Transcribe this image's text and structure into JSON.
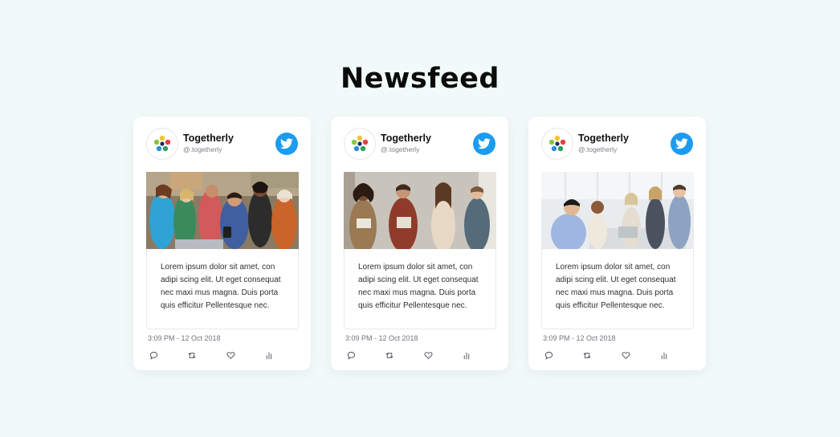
{
  "page": {
    "title": "Newsfeed"
  },
  "colors": {
    "background": "#f2f9f9",
    "twitter_blue": "#1d9bf0",
    "card": "#ffffff"
  },
  "cards": [
    {
      "account_name": "Togetherly",
      "handle": "@.togetherly",
      "image": "group of young friends laughing around a laptop",
      "body": "Lorem ipsum dolor sit amet, con adipi scing elit. Ut eget consequat nec maxi mus magna. Duis porta quis efficitur Pellentesque nec.",
      "timestamp": "3:09 PM - 12 Oct 2018",
      "icons": [
        "reply-icon",
        "retweet-icon",
        "heart-icon",
        "stats-icon"
      ]
    },
    {
      "account_name": "Togetherly",
      "handle": "@.togetherly",
      "image": "four colleagues standing in an office holding tablets",
      "body": "Lorem ipsum dolor sit amet, con adipi scing elit. Ut eget consequat nec maxi mus magna. Duis porta quis efficitur Pellentesque nec.",
      "timestamp": "3:09 PM - 12 Oct 2018",
      "icons": [
        "reply-icon",
        "retweet-icon",
        "heart-icon",
        "stats-icon"
      ]
    },
    {
      "account_name": "Togetherly",
      "handle": "@.togetherly",
      "image": "office team giving thumbs up",
      "body": "Lorem ipsum dolor sit amet, con adipi scing elit. Ut eget consequat nec maxi mus magna. Duis porta quis efficitur Pellentesque nec.",
      "timestamp": "3:09 PM - 12 Oct 2018",
      "icons": [
        "reply-icon",
        "retweet-icon",
        "heart-icon",
        "stats-icon"
      ]
    }
  ]
}
